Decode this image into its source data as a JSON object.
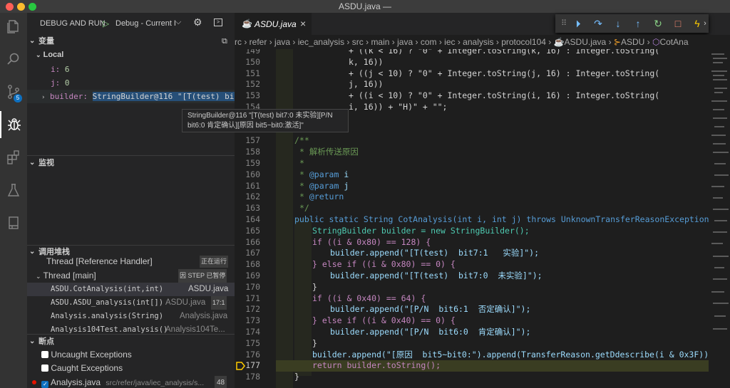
{
  "window": {
    "title": "ASDU.java —"
  },
  "debug_header": {
    "title": "DEBUG AND RUN",
    "config": "Debug - Current I"
  },
  "variables": {
    "title": "变量",
    "local_label": "Local",
    "items": [
      {
        "name": "i:",
        "value": "6"
      },
      {
        "name": "j:",
        "value": "0"
      },
      {
        "name": "builder:",
        "value": "StringBuilder@116 \"[T(test) bit7:0…"
      }
    ]
  },
  "tooltip": {
    "line1": "StringBuilder@116 \"[T(test) bit7:0  未实验][P/N",
    "line2": "bit6:0  肯定确认][原因  bit5~bit0:激活]\""
  },
  "watch": {
    "title": "监视"
  },
  "callstack": {
    "title": "调用堆栈",
    "threads": [
      {
        "name": "Thread [Reference Handler]",
        "state": "正在运行"
      },
      {
        "name": "Thread [main]",
        "state": "因 STEP 已暂停"
      }
    ],
    "frames": [
      {
        "method": "ASDU.CotAnalysis(int,int)",
        "file": "ASDU.java"
      },
      {
        "method": "ASDU.ASDU_analysis(int[])",
        "file": "ASDU.java",
        "line": "17:1"
      },
      {
        "method": "Analysis.analysis(String)",
        "file": "Analysis.java"
      },
      {
        "method": "Analysis104Test.analysis()",
        "file": "Analysis104Te..."
      }
    ]
  },
  "breakpoints": {
    "title": "断点",
    "items": [
      {
        "label": "Uncaught Exceptions",
        "checked": false
      },
      {
        "label": "Caught Exceptions",
        "checked": false
      },
      {
        "label": "Analysis.java",
        "path": "src/refer/java/iec_analysis/s...",
        "count": "48",
        "checked": true
      }
    ]
  },
  "tab": {
    "label": "ASDU.java",
    "close": "×"
  },
  "breadcrumbs": [
    "rc",
    "refer",
    "java",
    "iec_analysis",
    "src",
    "main",
    "java",
    "com",
    "iec",
    "analysis",
    "protocol104",
    "ASDU.java",
    "ASDU",
    "CotAna"
  ],
  "gutter_numbers": [
    "149",
    "150",
    "151",
    "152",
    "153",
    "154",
    "155",
    "156",
    "157",
    "158",
    "159",
    "160",
    "161",
    "162",
    "163",
    "164",
    "165",
    "166",
    "167",
    "168",
    "169",
    "170",
    "171",
    "172",
    "173",
    "174",
    "175",
    "176",
    "177",
    "178"
  ],
  "code": {
    "l149": "+ ((k < 16) ? \"0\" + Integer.toString(k, 16) : Integer.toString(",
    "l150": "k, 16))",
    "l151": "+ ((j < 10) ? \"0\" + Integer.toString(j, 16) : Integer.toString(",
    "l152": "j, 16))",
    "l153": "+ ((i < 10) ? \"0\" + Integer.toString(i, 16) : Integer.toString(",
    "l154": "i, 16)) + \"H)\" + \"\";",
    "l157": "/**",
    "l158": "* 解析传送原因",
    "l159": "*",
    "l160a": "* ",
    "l160b": "@param",
    "l160c": " i",
    "l161a": "* ",
    "l161b": "@param",
    "l161c": " j",
    "l162a": "* ",
    "l162b": "@return",
    "l163": "*/",
    "l164": "public static String CotAnalysis(int i, int j) throws UnknownTransferReasonException {",
    "l165": "StringBuilder builder = new StringBuilder();",
    "l166": "if ((i & 0x80) == 128) {",
    "l167": "builder.append(\"[T(test)  bit7:1   实验]\");",
    "l168": "} else if ((i & 0x80) == 0) {",
    "l169": "builder.append(\"[T(test)  bit7:0  未实验]\");",
    "l170": "}",
    "l171": "if ((i & 0x40) == 64) {",
    "l172": "builder.append(\"[P/N  bit6:1  否定确认]\");",
    "l173": "} else if ((i & 0x40) == 0) {",
    "l174": "builder.append(\"[P/N  bit6:0  肯定确认]\");",
    "l175": "}",
    "l176": "builder.append(\"[原因  bit5~bit0:\").append(TransferReason.getDdescribe(i & 0x3F)).append",
    "l177": "return builder.toString();",
    "l178": "}"
  },
  "icons": {
    "explorer": "files-icon",
    "search": "search-icon",
    "scm": "source-control-icon",
    "scm_badge": "5",
    "debug": "debug-icon",
    "extensions": "extensions-icon",
    "testing": "flask-icon",
    "remote": "book-icon"
  },
  "colors": {
    "accent": "#0e70c0",
    "selection": "#37373d",
    "current_line": "#3a3d22",
    "arrow": "#ffcc00"
  }
}
